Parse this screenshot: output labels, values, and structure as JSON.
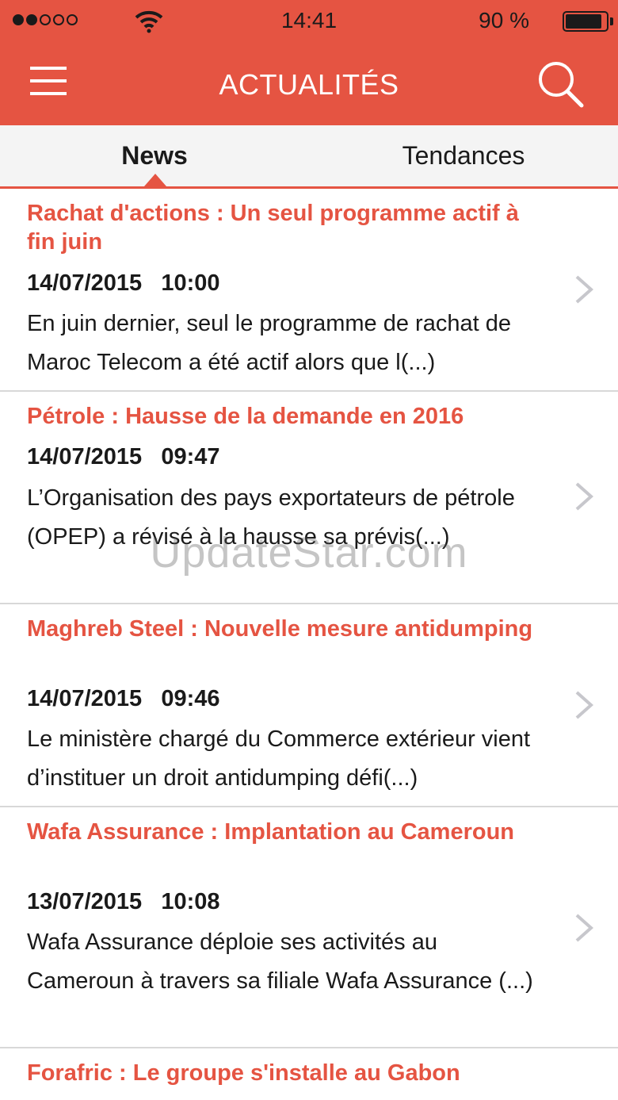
{
  "status_bar": {
    "time": "14:41",
    "battery_percent": "90 %",
    "battery_level": 0.9,
    "signal_bars_filled": 2,
    "signal_bars_total": 5
  },
  "header": {
    "title": "ACTUALITÉS",
    "menu_icon": "menu-icon",
    "search_icon": "search-icon",
    "accent_color": "#e55442"
  },
  "tabs": [
    {
      "label": "News",
      "active": true
    },
    {
      "label": "Tendances",
      "active": false
    }
  ],
  "articles": [
    {
      "title": "Rachat d'actions : Un seul programme actif à fin juin",
      "date": "14/07/2015",
      "time": "10:00",
      "excerpt": "En juin dernier, seul le programme de rachat de Maroc Telecom a été actif alors que l(...)"
    },
    {
      "title": "Pétrole : Hausse de la demande en 2016",
      "date": "14/07/2015",
      "time": "09:47",
      "excerpt": "L’Organisation des pays exportateurs de pétrole (OPEP) a révisé à la hausse sa prévis(...)"
    },
    {
      "title": "Maghreb Steel : Nouvelle mesure antidumping",
      "date": "14/07/2015",
      "time": "09:46",
      "excerpt": "Le ministère chargé du Commerce extérieur vient d’instituer un droit antidumping défi(...)"
    },
    {
      "title": "Wafa Assurance : Implantation au Cameroun",
      "date": "13/07/2015",
      "time": "10:08",
      "excerpt": "Wafa Assurance déploie ses activités au Cameroun à travers sa filiale Wafa Assurance (...)"
    },
    {
      "title": "Forafric : Le groupe s'installe au Gabon"
    }
  ],
  "watermark": "UpdateStar.com"
}
